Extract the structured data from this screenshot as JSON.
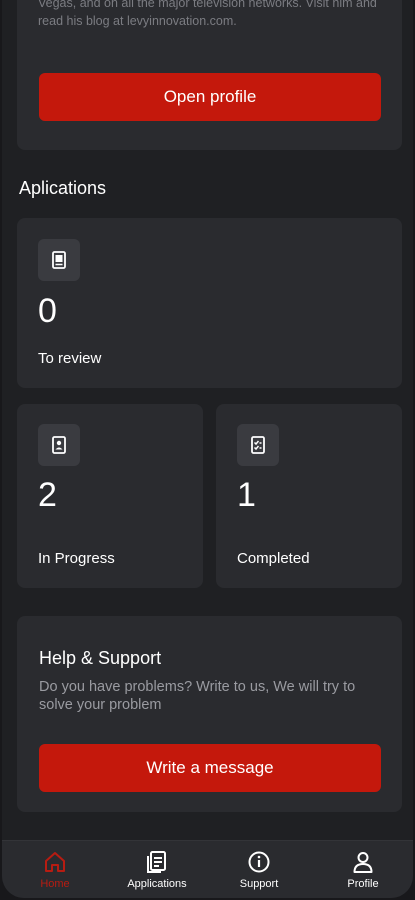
{
  "profile_card": {
    "bio_text": "Vegas, and on all the major television networks. Visit him and read his blog at levyinnovation.com.",
    "open_profile_label": "Open profile"
  },
  "applications": {
    "section_title": "Aplications",
    "to_review": {
      "count": "0",
      "label": "To review",
      "icon": "document-icon"
    },
    "in_progress": {
      "count": "2",
      "label": "In Progress",
      "icon": "id-card-icon"
    },
    "completed": {
      "count": "1",
      "label": "Completed",
      "icon": "checklist-icon"
    }
  },
  "help": {
    "title": "Help & Support",
    "text": "Do you have problems? Write to us, We will try to solve your problem",
    "button_label": "Write a message"
  },
  "tabbar": {
    "items": [
      {
        "label": "Home",
        "icon": "home-icon",
        "active": true
      },
      {
        "label": "Applications",
        "icon": "applications-icon",
        "active": false
      },
      {
        "label": "Support",
        "icon": "info-icon",
        "active": false
      },
      {
        "label": "Profile",
        "icon": "person-icon",
        "active": false
      }
    ]
  },
  "colors": {
    "accent": "#c4180c",
    "background": "#1f2023",
    "card": "#2a2b2f",
    "active_tab": "#b71c12"
  }
}
